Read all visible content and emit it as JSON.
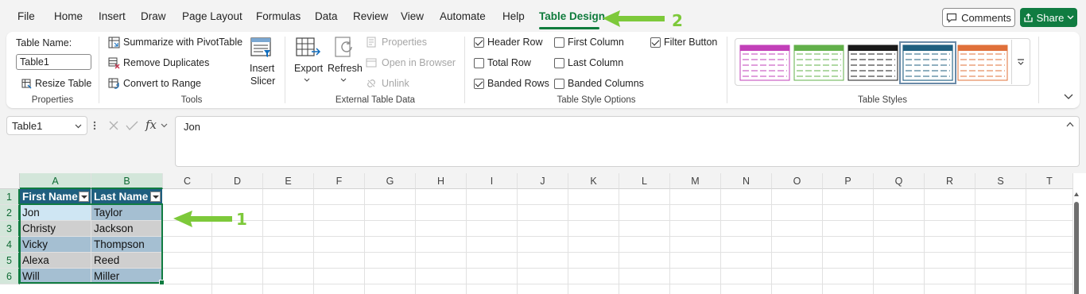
{
  "menu": {
    "tabs": [
      "File",
      "Home",
      "Insert",
      "Draw",
      "Page Layout",
      "Formulas",
      "Data",
      "Review",
      "View",
      "Automate",
      "Help",
      "Table Design"
    ],
    "active": "Table Design",
    "comments_label": "Comments",
    "share_label": "Share"
  },
  "ribbon": {
    "properties": {
      "table_name_label": "Table Name:",
      "table_name_value": "Table1",
      "resize_label": "Resize Table",
      "group_label": "Properties"
    },
    "tools": {
      "summarize_label": "Summarize with PivotTable",
      "remove_duplicates_label": "Remove Duplicates",
      "convert_label": "Convert to Range",
      "slicer_label_1": "Insert",
      "slicer_label_2": "Slicer",
      "group_label": "Tools"
    },
    "external": {
      "export_label": "Export",
      "refresh_label": "Refresh",
      "properties_label": "Properties",
      "open_browser_label": "Open in Browser",
      "unlink_label": "Unlink",
      "group_label": "External Table Data"
    },
    "style_options": {
      "header_row": {
        "label": "Header Row",
        "checked": true
      },
      "total_row": {
        "label": "Total Row",
        "checked": false
      },
      "banded_rows": {
        "label": "Banded Rows",
        "checked": true
      },
      "first_column": {
        "label": "First Column",
        "checked": false
      },
      "last_column": {
        "label": "Last Column",
        "checked": false
      },
      "banded_columns": {
        "label": "Banded Columns",
        "checked": false
      },
      "filter_button": {
        "label": "Filter Button",
        "checked": true
      },
      "group_label": "Table Style Options"
    },
    "table_styles": {
      "group_label": "Table Styles",
      "thumb_colors": [
        "#c23fb8",
        "#62b04a",
        "#1a1a1a",
        "#1f5f7f",
        "#e0703a"
      ],
      "selected_index": 3
    }
  },
  "formula_bar": {
    "name_box": "Table1",
    "fx": "fx",
    "content": "Jon"
  },
  "grid": {
    "columns": [
      "A",
      "B",
      "C",
      "D",
      "E",
      "F",
      "G",
      "H",
      "I",
      "J",
      "K",
      "L",
      "M",
      "N",
      "O",
      "P",
      "Q",
      "R",
      "S",
      "T"
    ],
    "rows": [
      "1",
      "2",
      "3",
      "4",
      "5",
      "6"
    ],
    "table": {
      "headers": [
        "First Name",
        "Last Name"
      ],
      "data": [
        [
          "Jon",
          "Taylor"
        ],
        [
          "Christy",
          "Jackson"
        ],
        [
          "Vicky",
          "Thompson"
        ],
        [
          "Alexa",
          "Reed"
        ],
        [
          "Will",
          "Miller"
        ]
      ],
      "header_color": "#1f5f7f",
      "band_colors": [
        "#a5bfd2",
        "#cfcfcf"
      ]
    }
  },
  "annotations": {
    "arrow1_label": "1",
    "arrow2_label": "2",
    "arrow_color": "#7dc93a"
  }
}
